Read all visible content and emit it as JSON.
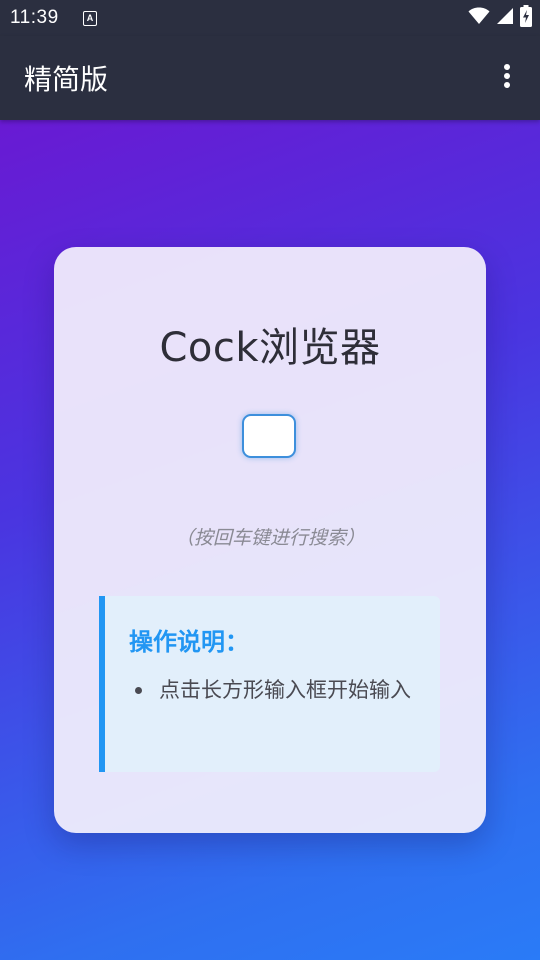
{
  "status_bar": {
    "time": "11:39",
    "notification_icon_letter": "A",
    "icons": [
      "wifi-icon",
      "signal-icon",
      "battery-charging-icon"
    ]
  },
  "app_bar": {
    "title": "精简版",
    "menu_icon": "more-vertical-icon"
  },
  "card": {
    "title": "Cock浏览器",
    "search_input": {
      "value": "",
      "placeholder": ""
    },
    "hint": "（按回车键进行搜索）",
    "instructions": {
      "heading": "操作说明：",
      "items": [
        "点击长方形输入框开始输入"
      ]
    }
  },
  "colors": {
    "status_bar_bg": "#2b2f40",
    "gradient_start": "#7212cf",
    "gradient_end": "#2a7bf7",
    "accent_blue": "#2196f3"
  }
}
